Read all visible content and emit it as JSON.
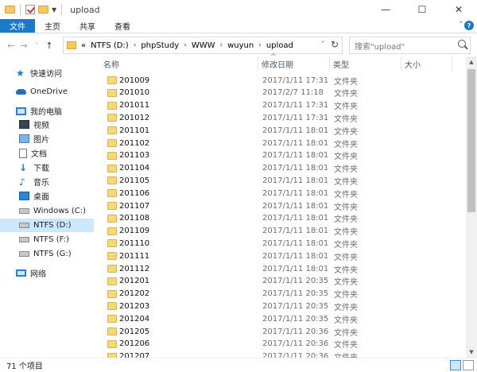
{
  "window": {
    "title": "upload",
    "controls": [
      "—",
      "☐",
      "✕"
    ]
  },
  "ribbon": {
    "tabs": [
      "文件",
      "主页",
      "共享",
      "查看"
    ]
  },
  "nav": {
    "back": "←",
    "forward": "→",
    "recent": "˅",
    "up": "↑",
    "address_prefix": "«",
    "path": [
      "NTFS (D:)",
      "phpStudy",
      "WWW",
      "wuyun",
      "upload"
    ],
    "search_placeholder": "搜索\"upload\""
  },
  "sidebar": {
    "items": [
      {
        "label": "快速访问",
        "icon": "star-icon"
      },
      {
        "label": "OneDrive",
        "icon": "cloud-icon"
      },
      {
        "label": "我的电脑",
        "icon": "computer-icon"
      },
      {
        "label": "视频",
        "icon": "video-icon"
      },
      {
        "label": "图片",
        "icon": "picture-icon"
      },
      {
        "label": "文档",
        "icon": "document-icon"
      },
      {
        "label": "下载",
        "icon": "download-icon"
      },
      {
        "label": "音乐",
        "icon": "music-icon"
      },
      {
        "label": "桌面",
        "icon": "desktop-icon"
      },
      {
        "label": "Windows (C:)",
        "icon": "drive-icon"
      },
      {
        "label": "NTFS (D:)",
        "icon": "drive-icon",
        "selected": true
      },
      {
        "label": "NTFS (F:)",
        "icon": "drive-icon"
      },
      {
        "label": "NTFS (G:)",
        "icon": "drive-icon"
      },
      {
        "label": "网络",
        "icon": "network-icon"
      }
    ]
  },
  "columns": {
    "name": "名称",
    "date": "修改日期",
    "type": "类型",
    "size": "大小"
  },
  "files": [
    {
      "name": "201009",
      "date": "2017/1/11 17:31",
      "type": "文件夹"
    },
    {
      "name": "201010",
      "date": "2017/2/7 11:18",
      "type": "文件夹"
    },
    {
      "name": "201011",
      "date": "2017/1/11 17:31",
      "type": "文件夹"
    },
    {
      "name": "201012",
      "date": "2017/1/11 17:31",
      "type": "文件夹"
    },
    {
      "name": "201101",
      "date": "2017/1/11 18:01",
      "type": "文件夹"
    },
    {
      "name": "201102",
      "date": "2017/1/11 18:01",
      "type": "文件夹"
    },
    {
      "name": "201103",
      "date": "2017/1/11 18:01",
      "type": "文件夹"
    },
    {
      "name": "201104",
      "date": "2017/1/11 18:01",
      "type": "文件夹"
    },
    {
      "name": "201105",
      "date": "2017/1/11 18:01",
      "type": "文件夹"
    },
    {
      "name": "201106",
      "date": "2017/1/11 18:01",
      "type": "文件夹"
    },
    {
      "name": "201107",
      "date": "2017/1/11 18:01",
      "type": "文件夹"
    },
    {
      "name": "201108",
      "date": "2017/1/11 18:01",
      "type": "文件夹"
    },
    {
      "name": "201109",
      "date": "2017/1/11 18:01",
      "type": "文件夹"
    },
    {
      "name": "201110",
      "date": "2017/1/11 18:01",
      "type": "文件夹"
    },
    {
      "name": "201111",
      "date": "2017/1/11 18:01",
      "type": "文件夹"
    },
    {
      "name": "201112",
      "date": "2017/1/11 18:01",
      "type": "文件夹"
    },
    {
      "name": "201201",
      "date": "2017/1/11 20:35",
      "type": "文件夹"
    },
    {
      "name": "201202",
      "date": "2017/1/11 20:35",
      "type": "文件夹"
    },
    {
      "name": "201203",
      "date": "2017/1/11 20:35",
      "type": "文件夹"
    },
    {
      "name": "201204",
      "date": "2017/1/11 20:35",
      "type": "文件夹"
    },
    {
      "name": "201205",
      "date": "2017/1/11 20:36",
      "type": "文件夹"
    },
    {
      "name": "201206",
      "date": "2017/1/11 20:36",
      "type": "文件夹"
    },
    {
      "name": "201207",
      "date": "2017/1/11 20:36",
      "type": "文件夹"
    }
  ],
  "status": {
    "count": "71 个项目"
  },
  "colors": {
    "accent": "#1979ca",
    "selection": "#cce8ff",
    "folder": "#f8d775"
  }
}
